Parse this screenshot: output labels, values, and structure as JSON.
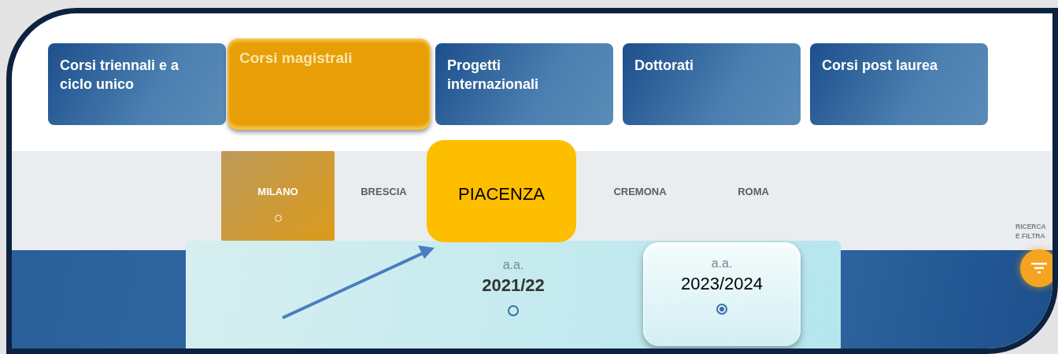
{
  "categories": [
    {
      "label": "Corsi triennali e a ciclo unico",
      "selected": false
    },
    {
      "label": "Corsi magistrali",
      "selected": true
    },
    {
      "label": "Progetti internazionali",
      "selected": false
    },
    {
      "label": "Dottorati",
      "selected": false
    },
    {
      "label": "Corsi post laurea",
      "selected": false
    }
  ],
  "campuses": [
    {
      "label": "MILANO",
      "selected": true,
      "highlighted": false
    },
    {
      "label": "BRESCIA",
      "selected": false,
      "highlighted": false
    },
    {
      "label": "PIACENZA",
      "selected": false,
      "highlighted": true
    },
    {
      "label": "CREMONA",
      "selected": false,
      "highlighted": false
    },
    {
      "label": "ROMA",
      "selected": false,
      "highlighted": false
    }
  ],
  "years": [
    {
      "label": "a.a.",
      "year": "2021/22",
      "selected": false,
      "highlighted": false
    },
    {
      "label": "a.a.",
      "year": "2023/2024",
      "selected": true,
      "highlighted": true
    }
  ],
  "filter": {
    "label": "RICERCA E FILTRA"
  }
}
